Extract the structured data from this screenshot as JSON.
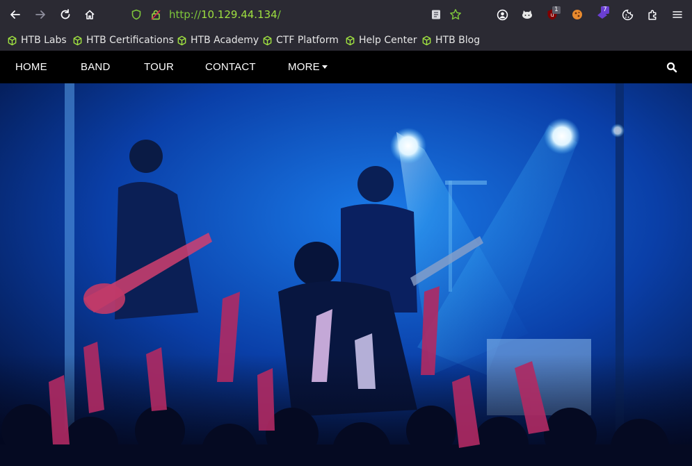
{
  "browser": {
    "url_scheme": "http://",
    "url_host": "10.129.44.134",
    "url_path": "/",
    "extension_badges": [
      "1",
      "7"
    ]
  },
  "bookmarks": [
    {
      "label": "HTB Labs"
    },
    {
      "label": "HTB Certifications"
    },
    {
      "label": "HTB Academy"
    },
    {
      "label": "CTF Platform"
    },
    {
      "label": "Help Center"
    },
    {
      "label": "HTB Blog"
    }
  ],
  "site": {
    "nav": [
      {
        "label": "HOME"
      },
      {
        "label": "BAND"
      },
      {
        "label": "TOUR"
      },
      {
        "label": "CONTACT"
      },
      {
        "label": "MORE"
      }
    ],
    "hero_image": "band-concert-photo"
  },
  "colors": {
    "accent_green": "#9fe040",
    "nav_bg": "#000000",
    "toolbar_bg": "#2b2a33"
  }
}
